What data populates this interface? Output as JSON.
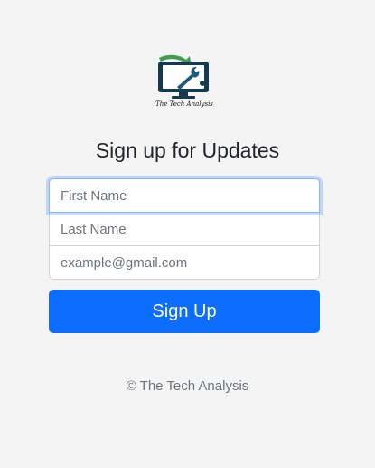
{
  "brand": {
    "logo_text": "The Tech Analysis"
  },
  "heading": "Sign up for Updates",
  "form": {
    "first_name_placeholder": "First Name",
    "last_name_placeholder": "Last Name",
    "email_placeholder": "example@gmail.com",
    "submit_label": "Sign Up"
  },
  "footer": {
    "copyright": "© The Tech Analysis"
  },
  "colors": {
    "background": "#f4f4f4",
    "primary_button": "#0d6efd",
    "focus_ring": "#86b7fe"
  }
}
